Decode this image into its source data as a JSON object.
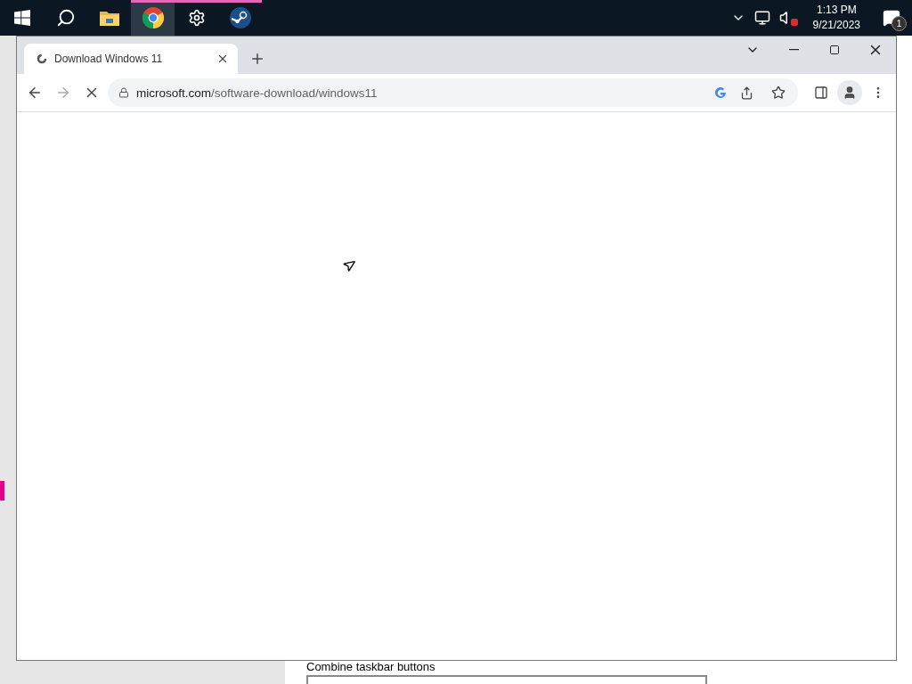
{
  "taskbar": {
    "apps": [
      {
        "kind": "start",
        "running": false,
        "selected": false
      },
      {
        "kind": "search",
        "running": false,
        "selected": false
      },
      {
        "kind": "folder",
        "running": false,
        "selected": false
      },
      {
        "kind": "chrome",
        "running": true,
        "selected": true
      },
      {
        "kind": "gear",
        "running": true,
        "selected": false
      },
      {
        "kind": "steam",
        "running": true,
        "selected": false
      }
    ],
    "tray": {
      "time": "1:13 PM",
      "date": "9/21/2023",
      "notifications": "1",
      "muted": true
    }
  },
  "settings_window": {
    "nav_selected": true,
    "setting_label": "Combine taskbar buttons"
  },
  "browser": {
    "tabs": [
      {
        "title": "Download Windows 11",
        "selected": true,
        "loading": true
      }
    ],
    "address": {
      "host": "microsoft.com",
      "path": "/software-download/windows11"
    }
  }
}
